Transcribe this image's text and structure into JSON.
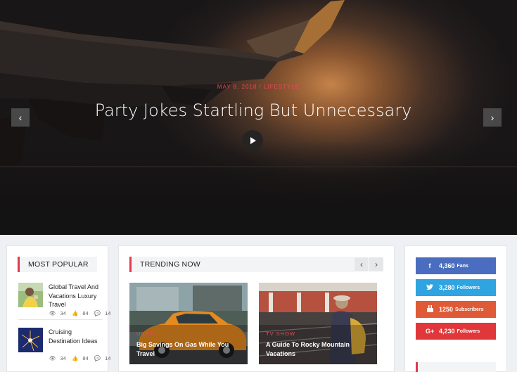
{
  "hero": {
    "meta": "MAY 8, 2018 / LIFESTYLE",
    "title": "Party Jokes Startling But Unnecessary",
    "prev_icon": "chevron-left-icon",
    "next_icon": "chevron-right-icon",
    "play_icon": "play-icon"
  },
  "most_popular": {
    "heading": "MOST POPULAR",
    "items": [
      {
        "title": "Global Travel And Vacations Luxury Travel",
        "views": "34",
        "likes": "84",
        "comments": "14"
      },
      {
        "title": "Cruising Destination Ideas",
        "views": "34",
        "likes": "84",
        "comments": "14"
      }
    ]
  },
  "trending": {
    "heading": "TRENDING NOW",
    "prev_label": "‹",
    "next_label": "›",
    "cards": [
      {
        "category": "USED",
        "title": "Big Savings On Gas While You Travel"
      },
      {
        "category": "TV SHOW",
        "title": "A Guide To Rocky Mountain Vacations"
      }
    ]
  },
  "social": [
    {
      "network": "facebook",
      "icon": "f",
      "count": "4,360",
      "label": "Fans",
      "color": "#4a6dc0"
    },
    {
      "network": "twitter",
      "icon": "twitter-icon",
      "count": "3,280",
      "label": "Followers",
      "color": "#2fa4e0"
    },
    {
      "network": "youtube",
      "icon": "youtube-icon",
      "count": "1250",
      "label": "Subscribers",
      "color": "#df5a36"
    },
    {
      "network": "google-plus",
      "icon": "G+",
      "count": "4,230",
      "label": "Followers",
      "color": "#e0383a"
    }
  ],
  "colors": {
    "accent": "#e1384c"
  }
}
